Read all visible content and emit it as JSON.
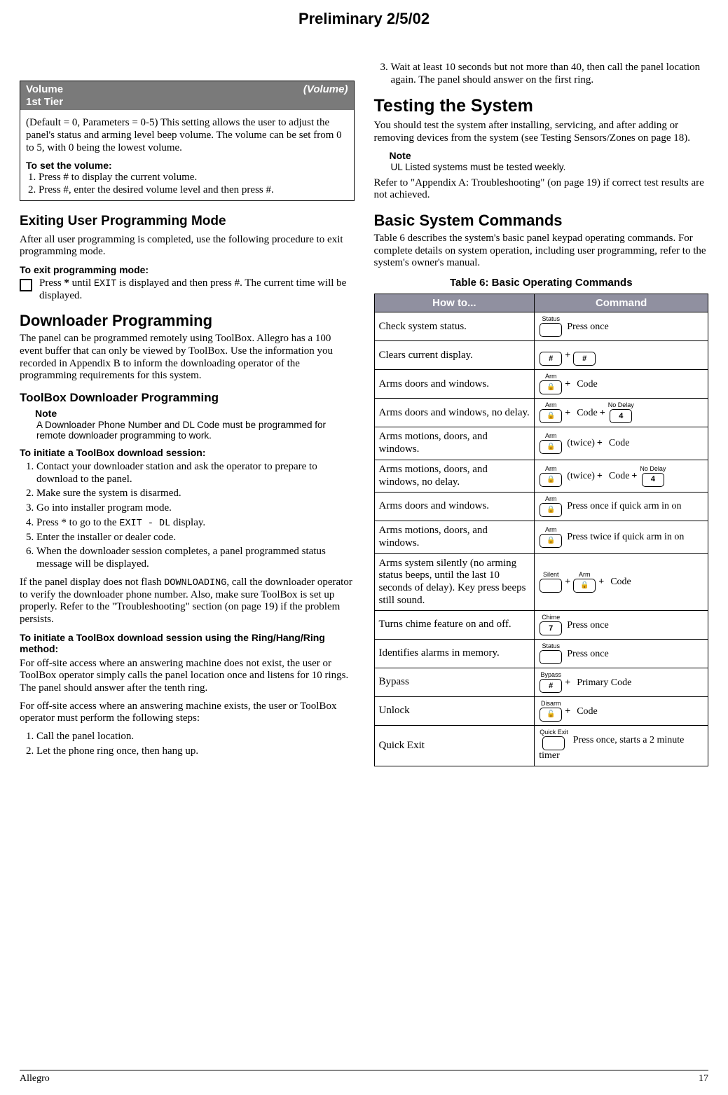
{
  "prelim": "Preliminary 2/5/02",
  "volbox": {
    "title_left": "Volume",
    "title_sub": "1st Tier",
    "title_right": "(Volume)",
    "intro": "(Default = 0, Parameters = 0-5) This setting allows the user to adjust the panel's status and arming level beep volume. The volume can be set from 0 to 5, with 0 being the lowest volume.",
    "proc_head": "To set the volume:",
    "steps": [
      "Press # to display the current volume.",
      "Press #, enter the desired volume level and then press #."
    ]
  },
  "left": {
    "exit_head": "Exiting User Programming Mode",
    "exit_lead": "After all user programming is completed, use the following procedure to exit programming mode.",
    "exit_proc_head": "To exit programming mode:",
    "exit_chk_pre": "Press ",
    "exit_chk_star": "*",
    "exit_chk_mid": " until ",
    "exit_chk_exit": "EXIT",
    "exit_chk_post": " is displayed and then press #. The current time will be displayed.",
    "dl_head": "Downloader Programming",
    "dl_para": "The panel can be programmed remotely using ToolBox. Allegro has a 100 event buffer that can only be viewed by ToolBox. Use the information you recorded in Appendix B to inform the downloading operator of the programming requirements for this system.",
    "tbx_head": "ToolBox Downloader Programming",
    "note_head": "Note",
    "note_body": "A Downloader Phone Number and DL Code must be programmed for remote downloader programming to work.",
    "init_head": "To initiate a ToolBox download session:",
    "init_steps": [
      "Contact your downloader station and ask the operator to prepare to download to the panel.",
      "Make sure the system is disarmed.",
      "Go into installer program mode.",
      {
        "pre": "Press * to go to the ",
        "tt": "EXIT - DL",
        "post": " display."
      },
      "Enter the installer or dealer code.",
      "When the downloader session completes, a panel programmed status message will be displayed."
    ],
    "panel_flash_pre": "If the panel display does not flash ",
    "panel_flash_tt": "DOWNLOADING",
    "panel_flash_post": ", call the downloader operator to verify the downloader phone number. Also, make sure ToolBox is set up properly. Refer to the \"Troubleshooting\" section (on page 19) if the problem persists.",
    "ring_head": "To initiate a ToolBox download session using the Ring/Hang/Ring method:",
    "ring_p1": "For off-site access where an answering machine does not exist, the user or ToolBox operator simply calls the panel location once and listens for 10 rings. The panel should answer after the tenth ring.",
    "ring_p2": "For off-site access where an answering machine exists, the user or ToolBox operator must perform the following steps:",
    "ring_steps": [
      "Call the panel location.",
      "Let the phone ring once, then hang up."
    ]
  },
  "right": {
    "step3": "Wait at least 10 seconds but not more than 40, then call the panel location again. The panel should answer on the first ring.",
    "test_head": "Testing the System",
    "test_p": "You should test the system after installing, servicing, and after adding or removing devices from the system (see Testing Sensors/Zones on page 18).",
    "note_head": "Note",
    "note_body": "UL Listed systems must be tested weekly.",
    "refer_p": "Refer to \"Appendix A: Troubleshooting\" (on page 19) if correct test results are not achieved.",
    "basic_head": "Basic System Commands",
    "basic_p": "Table 6 describes the system's basic panel keypad operating commands. For complete details on system operation, including user programming, refer to the system's owner's manual.",
    "tbl_title": "Table 6: Basic Operating Commands",
    "tbl_head_l": "How to...",
    "tbl_head_r": "Command",
    "rows": [
      {
        "how": "Check system status.",
        "cmd": [
          {
            "btn": {
              "cap": "Status",
              "glyph": ""
            }
          },
          {
            "txt": "Press once"
          }
        ]
      },
      {
        "how": "Clears current display.",
        "cmd": [
          {
            "btn": {
              "cap": "",
              "glyph": "#"
            }
          },
          {
            "plus": "+"
          },
          {
            "btn": {
              "cap": "",
              "glyph": "#"
            }
          }
        ]
      },
      {
        "how": "Arms doors and windows.",
        "cmd": [
          {
            "btn": {
              "cap": "Arm",
              "glyph": "lock"
            }
          },
          {
            "plus": "+"
          },
          {
            "txt": "Code"
          }
        ]
      },
      {
        "how": "Arms doors and windows, no delay.",
        "cmd": [
          {
            "btn": {
              "cap": "Arm",
              "glyph": "lock"
            }
          },
          {
            "plus": "+"
          },
          {
            "txt": "Code"
          },
          {
            "plus": "+"
          },
          {
            "btn": {
              "cap": "No Delay",
              "glyph": "4"
            }
          }
        ]
      },
      {
        "how": "Arms motions, doors, and windows.",
        "cmd": [
          {
            "btn": {
              "cap": "Arm",
              "glyph": "lock"
            }
          },
          {
            "txt": "(twice)"
          },
          {
            "plus": "+"
          },
          {
            "txt": "Code"
          }
        ]
      },
      {
        "how": "Arms motions, doors, and windows, no delay.",
        "cmd": [
          {
            "btn": {
              "cap": "Arm",
              "glyph": "lock"
            }
          },
          {
            "txt": "(twice)"
          },
          {
            "plus": "+"
          },
          {
            "txt": "Code"
          },
          {
            "plus": "+"
          },
          {
            "btn": {
              "cap": "No Delay",
              "glyph": "4"
            }
          }
        ]
      },
      {
        "how": "Arms doors and windows.",
        "cmd": [
          {
            "btn": {
              "cap": "Arm",
              "glyph": "lock"
            }
          },
          {
            "txt": "Press once if quick arm in on"
          }
        ]
      },
      {
        "how": "Arms motions, doors, and windows.",
        "cmd": [
          {
            "btn": {
              "cap": "Arm",
              "glyph": "lock"
            }
          },
          {
            "txt": "Press twice if quick arm in on"
          }
        ]
      },
      {
        "how": "Arms system silently (no arming status beeps, until the last 10 seconds of delay). Key press beeps still sound.",
        "cmd": [
          {
            "btn": {
              "cap": "Silent",
              "glyph": ""
            }
          },
          {
            "plus": "+"
          },
          {
            "btn": {
              "cap": "Arm",
              "glyph": "lock"
            }
          },
          {
            "plus": "+"
          },
          {
            "txt": "Code"
          }
        ]
      },
      {
        "how": "Turns chime feature on and off.",
        "cmd": [
          {
            "btn": {
              "cap": "Chime",
              "glyph": "7"
            }
          },
          {
            "txt": "Press once"
          }
        ]
      },
      {
        "how": "Identifies alarms in memory.",
        "cmd": [
          {
            "btn": {
              "cap": "Status",
              "glyph": ""
            }
          },
          {
            "txt": "Press once"
          }
        ]
      },
      {
        "how": "Bypass",
        "cmd": [
          {
            "btn": {
              "cap": "Bypass",
              "glyph": "#"
            }
          },
          {
            "plus": "+"
          },
          {
            "txt": "Primary Code"
          }
        ]
      },
      {
        "how": "Unlock",
        "cmd": [
          {
            "btn": {
              "cap": "Disarm",
              "glyph": "unlock"
            }
          },
          {
            "plus": "+"
          },
          {
            "txt": "Code"
          }
        ]
      },
      {
        "how": "Quick Exit",
        "cmd": [
          {
            "btn": {
              "cap": "Quick Exit",
              "glyph": ""
            }
          },
          {
            "txt": "Press once, starts a 2 minute timer"
          }
        ]
      }
    ]
  },
  "footer": {
    "left": "Allegro",
    "right": "17"
  }
}
